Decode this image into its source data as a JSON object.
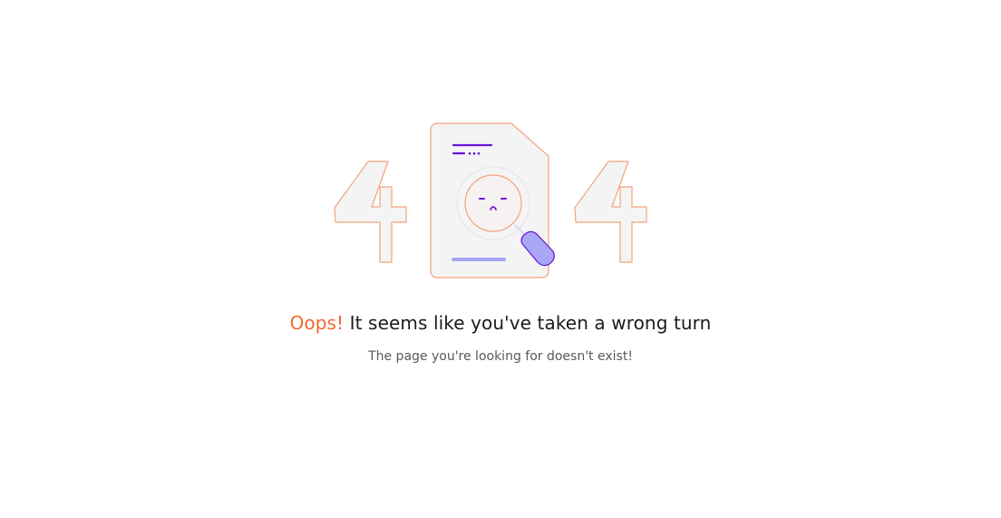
{
  "error_page": {
    "illustration_label": "404",
    "heading_accent": "Oops!",
    "heading_rest": "It seems like you've taken a wrong turn",
    "subtext": "The page you're looking for doesn't exist!"
  },
  "colors": {
    "accent": "#f26a2e",
    "outline": "#f4a27c",
    "purple": "#6a11d9",
    "lavender": "#a9a6f5",
    "fill": "#f4f4f4",
    "text_primary": "#1c1a1a",
    "text_secondary": "#5e5757"
  },
  "icons": [
    "digit-four-icon",
    "document-icon",
    "magnifier-icon",
    "sad-face-icon"
  ]
}
